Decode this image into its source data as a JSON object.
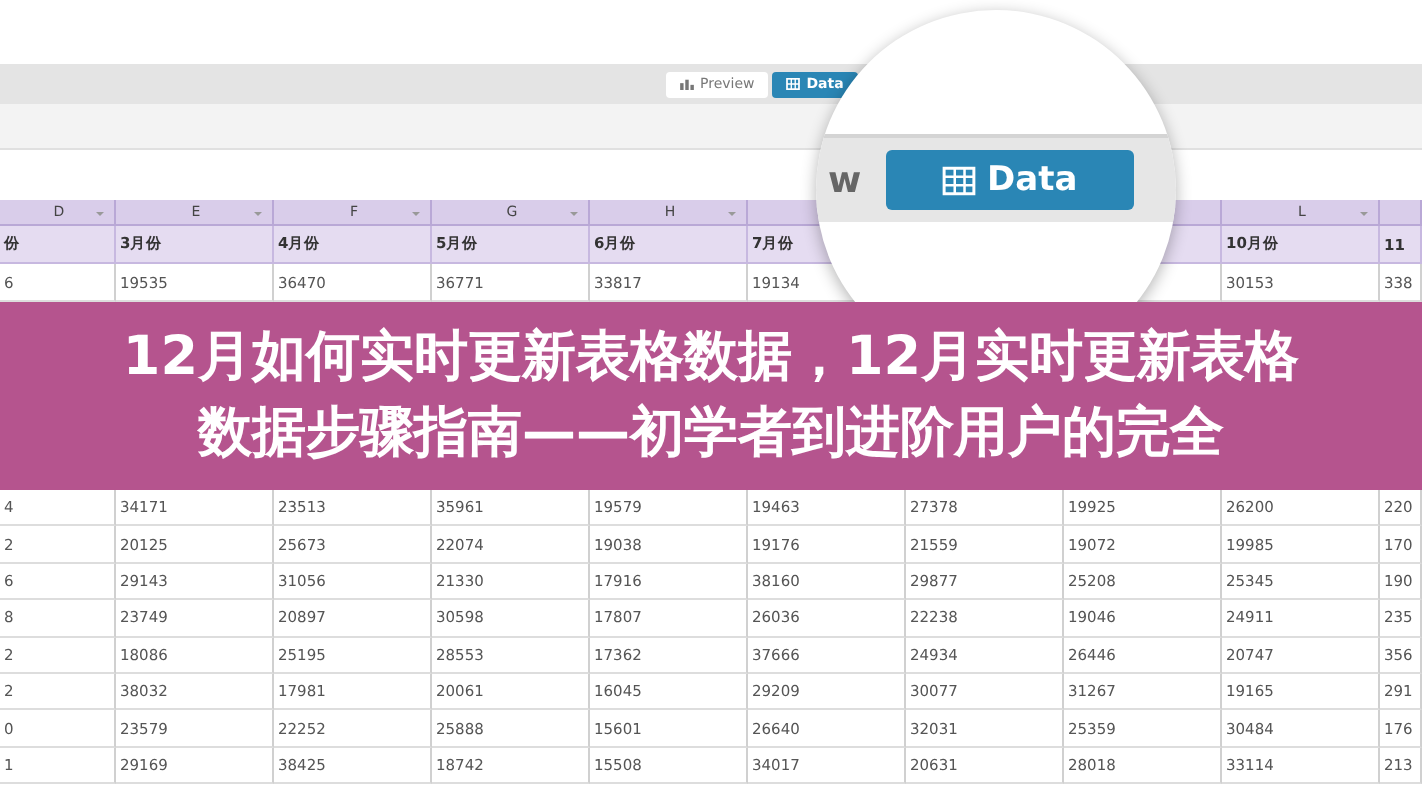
{
  "toolbar": {
    "tabs": [
      {
        "label": "Preview",
        "kind": "chart",
        "selected": false
      },
      {
        "label": "Data",
        "kind": "table",
        "selected": true
      }
    ]
  },
  "magnifier": {
    "cut_text": "w",
    "button": {
      "label": "Data",
      "kind": "table"
    }
  },
  "table": {
    "columns": [
      {
        "letter": "D",
        "month": "份",
        "value": "6"
      },
      {
        "letter": "E",
        "month": "3月份",
        "value": "19535"
      },
      {
        "letter": "F",
        "month": "4月份",
        "value": "36470"
      },
      {
        "letter": "G",
        "month": "5月份",
        "value": "36771"
      },
      {
        "letter": "H",
        "month": "6月份",
        "value": "33817"
      },
      {
        "month": "7月份",
        "value": "19134"
      },
      {},
      {},
      {
        "letter": "L",
        "month": "10月份",
        "value": "30153"
      },
      {
        "month": "11",
        "value": "338"
      }
    ],
    "rows": [
      [
        "4",
        "34171",
        "23513",
        "35961",
        "19579",
        "19463",
        "27378",
        "19925",
        "26200",
        "220"
      ],
      [
        "2",
        "20125",
        "25673",
        "22074",
        "19038",
        "19176",
        "21559",
        "19072",
        "19985",
        "170"
      ],
      [
        "6",
        "29143",
        "31056",
        "21330",
        "17916",
        "38160",
        "29877",
        "25208",
        "25345",
        "190"
      ],
      [
        "8",
        "23749",
        "20897",
        "30598",
        "17807",
        "26036",
        "22238",
        "19046",
        "24911",
        "235"
      ],
      [
        "2",
        "18086",
        "25195",
        "28553",
        "17362",
        "37666",
        "24934",
        "26446",
        "20747",
        "356"
      ],
      [
        "2",
        "38032",
        "17981",
        "20061",
        "16045",
        "29209",
        "30077",
        "31267",
        "19165",
        "291"
      ],
      [
        "0",
        "23579",
        "22252",
        "25888",
        "15601",
        "26640",
        "32031",
        "25359",
        "30484",
        "176"
      ],
      [
        "1",
        "29169",
        "38425",
        "18742",
        "15508",
        "34017",
        "20631",
        "28018",
        "33114",
        "213"
      ]
    ]
  },
  "banner": {
    "title": "12月如何实时更新表格数据，12月实时更新表格数据步骤指南——初学者到进阶用户的完全"
  }
}
